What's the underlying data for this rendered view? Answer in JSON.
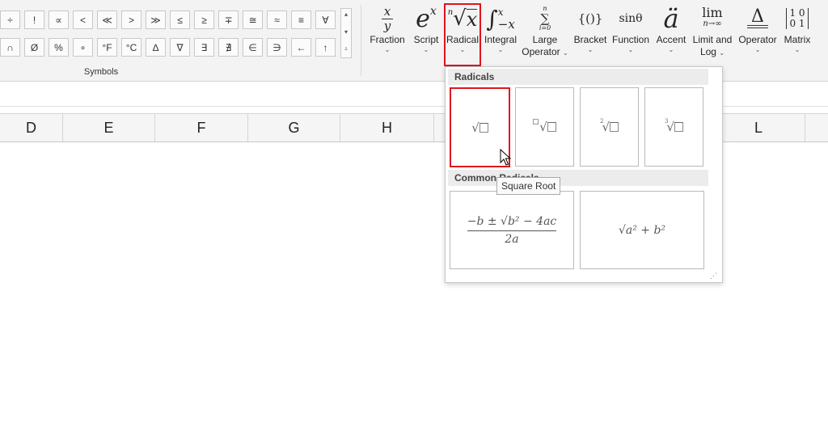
{
  "symbols_row1": [
    "÷",
    "!",
    "∝",
    "<",
    "≪",
    ">",
    "≫",
    "≤",
    "≥",
    "∓",
    "≅",
    "≈",
    "≡",
    "∀"
  ],
  "symbols_row2": [
    "∩",
    "Ø",
    "%",
    "∘",
    "°F",
    "°C",
    "∆",
    "∇",
    "∃",
    "∄",
    "∈",
    "∋",
    "←",
    "↑"
  ],
  "symbols_scroll": {
    "up": "▴",
    "down": "▾",
    "more": "⩡"
  },
  "symbols_group_label": "Symbols",
  "structures": [
    {
      "label": "Fraction",
      "chevron": "⌄"
    },
    {
      "label": "Script",
      "chevron": "⌄"
    },
    {
      "label": "Radical",
      "chevron": "⌄"
    },
    {
      "label": "Integral",
      "chevron": "⌄"
    },
    {
      "label": "Large",
      "label2": "Operator",
      "chevron": "⌄"
    },
    {
      "label": "Bracket",
      "chevron": "⌄"
    },
    {
      "label": "Function",
      "chevron": "⌄"
    },
    {
      "label": "Accent",
      "chevron": "⌄"
    },
    {
      "label": "Limit and",
      "label2": "Log",
      "chevron": "⌄"
    },
    {
      "label": "Operator",
      "chevron": "⌄"
    },
    {
      "label": "Matrix",
      "chevron": "⌄"
    }
  ],
  "glyphs": {
    "fraction_num": "x",
    "fraction_den": "y",
    "script_base": "e",
    "script_sup": "x",
    "radical_index": "n",
    "radical_sym": "√",
    "radical_arg": "x",
    "integral_sym": "∫",
    "integral_up": "x",
    "integral_low": "−x",
    "large_top": "n",
    "large_sym": "∑",
    "large_bottom": "i=0",
    "bracket": "{()}",
    "function": "sinθ",
    "accent": "ä",
    "limit_top": "lim",
    "limit_bottom": "n→∞",
    "operator": "Δ",
    "matrix_r1": "1 0",
    "matrix_r2": "0 1"
  },
  "columns": [
    "D",
    "E",
    "F",
    "G",
    "H",
    "L"
  ],
  "gallery": {
    "radicals_header": "Radicals",
    "common_header": "Common Radicals",
    "radical_tiles": [
      {
        "index": "",
        "name": "square-root"
      },
      {
        "index": "□",
        "name": "radical-with-degree"
      },
      {
        "index": "2",
        "name": "square-root-with-degree"
      },
      {
        "index": "3",
        "name": "cube-root"
      }
    ],
    "quadratic": {
      "numerator": "−b ± √b² − 4ac",
      "denominator": "2a"
    },
    "hypotenuse": "√a² + b²",
    "resize_grip": "⋰"
  },
  "tooltip": "Square Root",
  "colors": {
    "highlight": "#e0141e",
    "ribbon_bg": "#f3f3f3",
    "header_bg": "#f5f5f5"
  }
}
